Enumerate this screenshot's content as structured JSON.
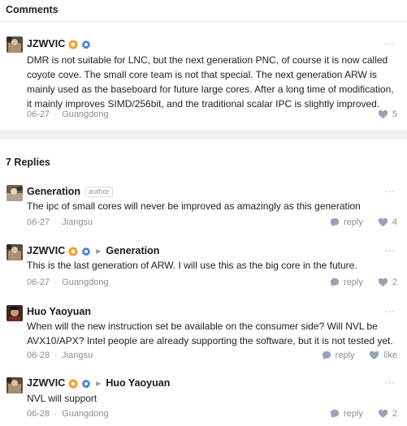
{
  "comments_header": "Comments",
  "replies_header": "7 Replies",
  "main_comment": {
    "user": "JZWVIC",
    "text": "DMR is not suitable for LNC, but the next generation PNC, of course it is now called coyote cove. The small core team is not that special. The next generation ARW is mainly used as the baseboard for future large cores. After a long time of modification, it mainly improves SIMD/256bit, and the traditional scalar IPC is slightly improved.",
    "date": "06-27",
    "location": "Guangdong",
    "likes": "5",
    "more": "···"
  },
  "replies": [
    {
      "user": "Generation",
      "author_tag": "author",
      "text": "The ipc of small cores will never be improved as amazingly as this generation",
      "date": "06-27",
      "location": "Jiangsu",
      "reply_label": "reply",
      "likes": "4",
      "more": "···"
    },
    {
      "user": "JZWVIC",
      "reply_to": "Generation",
      "text": "This is the last generation of ARW. I will use this as the big core in the future.",
      "date": "06-27",
      "location": "Guangdong",
      "reply_label": "reply",
      "likes": "2",
      "more": "···"
    },
    {
      "user": "Huo Yaoyuan",
      "text": "When will the new instruction set be available on the consumer side? Will NVL be AVX10/APX? Intel people are already supporting the software, but it is not tested yet.",
      "date": "06-28",
      "location": "Jiangsu",
      "reply_label": "reply",
      "likes": "like",
      "more": "···"
    },
    {
      "user": "JZWVIC",
      "reply_to": "Huo Yaoyuan",
      "text": "NVL will support",
      "date": "06-28",
      "location": "Guangdong",
      "reply_label": "reply",
      "likes": "2",
      "more": "···"
    }
  ],
  "meta_separator": "·",
  "colors": {
    "badge_orange": "#f0a12b",
    "badge_blue": "#4f7fd8",
    "icon_gray": "#9aa3b5",
    "muted_text": "#8f8f8f"
  }
}
